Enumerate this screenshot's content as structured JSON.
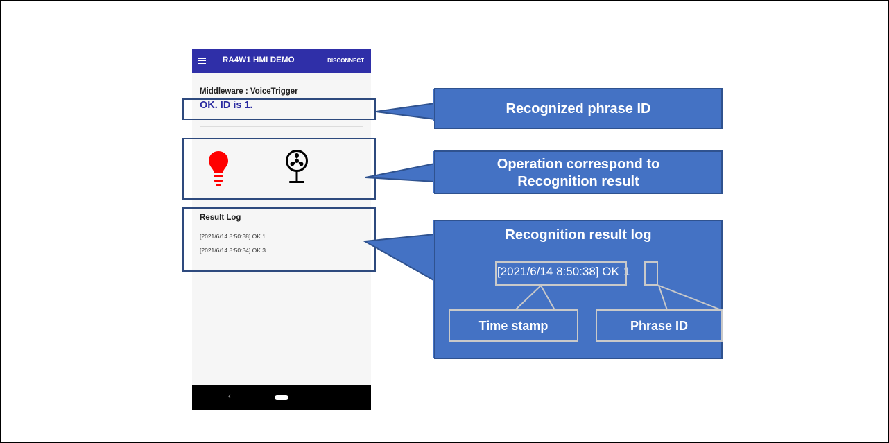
{
  "appbar": {
    "title": "RA4W1 HMI DEMO",
    "disconnect_label": "DISCONNECT",
    "menu_icon": "hamburger-menu-icon"
  },
  "main": {
    "middleware_label": "Middleware : VoiceTrigger",
    "status_text": "OK. ID is 1.",
    "icons": [
      "lightbulb-icon",
      "fan-icon"
    ],
    "bulb_color": "#ff0000"
  },
  "log": {
    "title": "Result Log",
    "entries": [
      "[2021/6/14 8:50:38] OK 1",
      "[2021/6/14 8:50:34] OK 3"
    ]
  },
  "navbar": {
    "back_icon": "back-chevron-icon",
    "home_icon": "home-pill-icon"
  },
  "callouts": {
    "phrase_id": "Recognized phrase ID",
    "operation_line1": "Operation correspond to",
    "operation_line2": "Recognition result",
    "result_log": "Recognition result log",
    "example_timestamp": "[2021/6/14 8:50:38]",
    "example_ok": "OK",
    "example_id": "1",
    "time_stamp_label": "Time stamp",
    "phrase_id_label": "Phrase ID"
  },
  "colors": {
    "appbar": "#2f2fa8",
    "status_text": "#2a2aa0",
    "callout_fill": "#4472c4",
    "callout_border": "#2f528f",
    "highlight_border": "#2e4a7e"
  }
}
